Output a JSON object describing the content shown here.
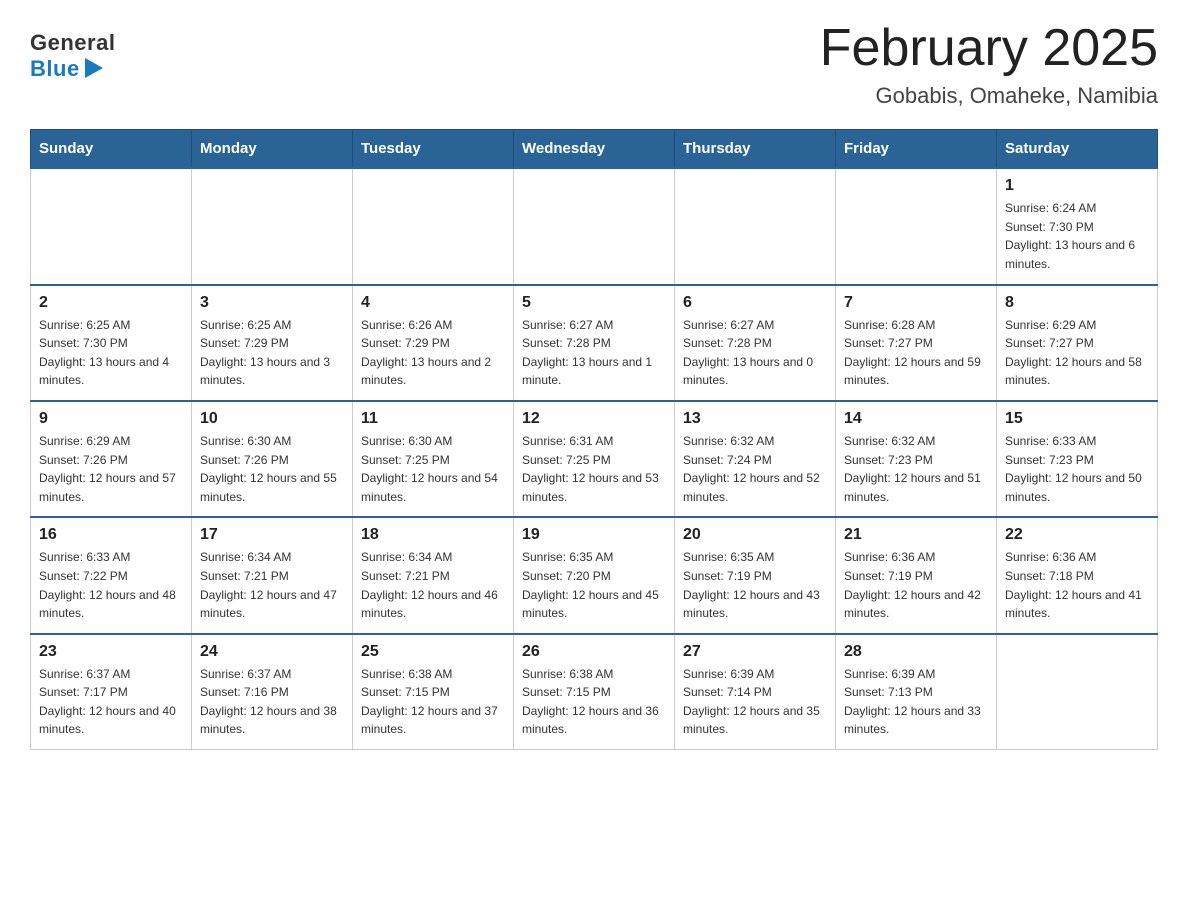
{
  "logo": {
    "general": "General",
    "blue": "Blue"
  },
  "header": {
    "month_year": "February 2025",
    "location": "Gobabis, Omaheke, Namibia"
  },
  "days_of_week": [
    "Sunday",
    "Monday",
    "Tuesday",
    "Wednesday",
    "Thursday",
    "Friday",
    "Saturday"
  ],
  "weeks": [
    [
      {
        "day": "",
        "info": ""
      },
      {
        "day": "",
        "info": ""
      },
      {
        "day": "",
        "info": ""
      },
      {
        "day": "",
        "info": ""
      },
      {
        "day": "",
        "info": ""
      },
      {
        "day": "",
        "info": ""
      },
      {
        "day": "1",
        "info": "Sunrise: 6:24 AM\nSunset: 7:30 PM\nDaylight: 13 hours and 6 minutes."
      }
    ],
    [
      {
        "day": "2",
        "info": "Sunrise: 6:25 AM\nSunset: 7:30 PM\nDaylight: 13 hours and 4 minutes."
      },
      {
        "day": "3",
        "info": "Sunrise: 6:25 AM\nSunset: 7:29 PM\nDaylight: 13 hours and 3 minutes."
      },
      {
        "day": "4",
        "info": "Sunrise: 6:26 AM\nSunset: 7:29 PM\nDaylight: 13 hours and 2 minutes."
      },
      {
        "day": "5",
        "info": "Sunrise: 6:27 AM\nSunset: 7:28 PM\nDaylight: 13 hours and 1 minute."
      },
      {
        "day": "6",
        "info": "Sunrise: 6:27 AM\nSunset: 7:28 PM\nDaylight: 13 hours and 0 minutes."
      },
      {
        "day": "7",
        "info": "Sunrise: 6:28 AM\nSunset: 7:27 PM\nDaylight: 12 hours and 59 minutes."
      },
      {
        "day": "8",
        "info": "Sunrise: 6:29 AM\nSunset: 7:27 PM\nDaylight: 12 hours and 58 minutes."
      }
    ],
    [
      {
        "day": "9",
        "info": "Sunrise: 6:29 AM\nSunset: 7:26 PM\nDaylight: 12 hours and 57 minutes."
      },
      {
        "day": "10",
        "info": "Sunrise: 6:30 AM\nSunset: 7:26 PM\nDaylight: 12 hours and 55 minutes."
      },
      {
        "day": "11",
        "info": "Sunrise: 6:30 AM\nSunset: 7:25 PM\nDaylight: 12 hours and 54 minutes."
      },
      {
        "day": "12",
        "info": "Sunrise: 6:31 AM\nSunset: 7:25 PM\nDaylight: 12 hours and 53 minutes."
      },
      {
        "day": "13",
        "info": "Sunrise: 6:32 AM\nSunset: 7:24 PM\nDaylight: 12 hours and 52 minutes."
      },
      {
        "day": "14",
        "info": "Sunrise: 6:32 AM\nSunset: 7:23 PM\nDaylight: 12 hours and 51 minutes."
      },
      {
        "day": "15",
        "info": "Sunrise: 6:33 AM\nSunset: 7:23 PM\nDaylight: 12 hours and 50 minutes."
      }
    ],
    [
      {
        "day": "16",
        "info": "Sunrise: 6:33 AM\nSunset: 7:22 PM\nDaylight: 12 hours and 48 minutes."
      },
      {
        "day": "17",
        "info": "Sunrise: 6:34 AM\nSunset: 7:21 PM\nDaylight: 12 hours and 47 minutes."
      },
      {
        "day": "18",
        "info": "Sunrise: 6:34 AM\nSunset: 7:21 PM\nDaylight: 12 hours and 46 minutes."
      },
      {
        "day": "19",
        "info": "Sunrise: 6:35 AM\nSunset: 7:20 PM\nDaylight: 12 hours and 45 minutes."
      },
      {
        "day": "20",
        "info": "Sunrise: 6:35 AM\nSunset: 7:19 PM\nDaylight: 12 hours and 43 minutes."
      },
      {
        "day": "21",
        "info": "Sunrise: 6:36 AM\nSunset: 7:19 PM\nDaylight: 12 hours and 42 minutes."
      },
      {
        "day": "22",
        "info": "Sunrise: 6:36 AM\nSunset: 7:18 PM\nDaylight: 12 hours and 41 minutes."
      }
    ],
    [
      {
        "day": "23",
        "info": "Sunrise: 6:37 AM\nSunset: 7:17 PM\nDaylight: 12 hours and 40 minutes."
      },
      {
        "day": "24",
        "info": "Sunrise: 6:37 AM\nSunset: 7:16 PM\nDaylight: 12 hours and 38 minutes."
      },
      {
        "day": "25",
        "info": "Sunrise: 6:38 AM\nSunset: 7:15 PM\nDaylight: 12 hours and 37 minutes."
      },
      {
        "day": "26",
        "info": "Sunrise: 6:38 AM\nSunset: 7:15 PM\nDaylight: 12 hours and 36 minutes."
      },
      {
        "day": "27",
        "info": "Sunrise: 6:39 AM\nSunset: 7:14 PM\nDaylight: 12 hours and 35 minutes."
      },
      {
        "day": "28",
        "info": "Sunrise: 6:39 AM\nSunset: 7:13 PM\nDaylight: 12 hours and 33 minutes."
      },
      {
        "day": "",
        "info": ""
      }
    ]
  ]
}
